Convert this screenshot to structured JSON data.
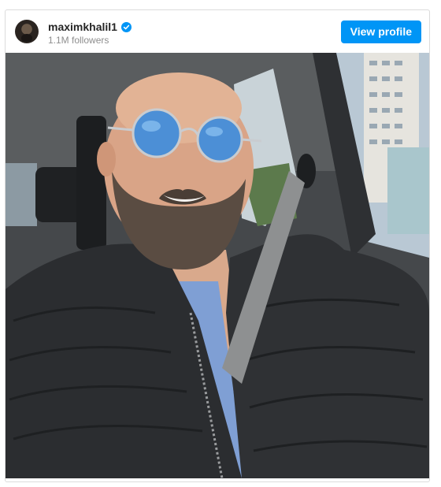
{
  "post": {
    "username": "maximkhalil1",
    "followers": "1.1M followers",
    "view_profile_label": "View profile",
    "verified_icon": "verified-badge-icon",
    "avatar_icon": "profile-avatar"
  },
  "colors": {
    "accent": "#0095f6",
    "verified": "#0095f6",
    "jacket": "#2b2d30"
  }
}
